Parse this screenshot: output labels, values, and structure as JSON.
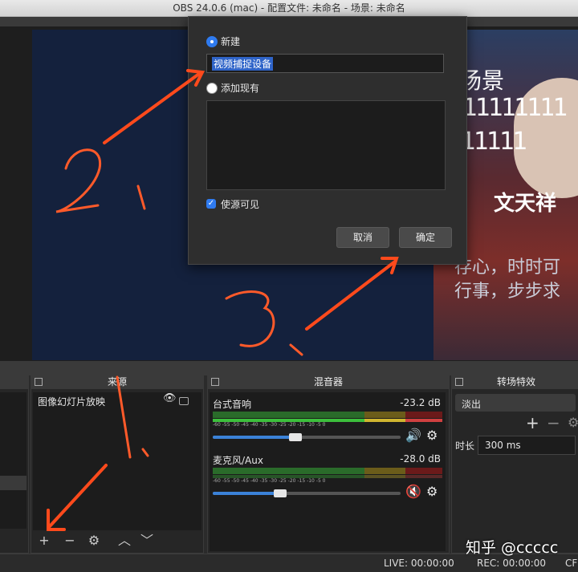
{
  "window": {
    "title": "OBS 24.0.6 (mac) - 配置文件: 未命名 - 场景: 未命名"
  },
  "preview": {
    "line1": "场景",
    "line2": "111111111",
    "line3": "11111",
    "name_text": "文天祥",
    "line4": "存心，时时可",
    "line5": "行事，步步求"
  },
  "dialog": {
    "new_label": "新建",
    "name_value": "视频捕捉设备",
    "add_existing_label": "添加现有",
    "visible_label": "使源可见",
    "cancel": "取消",
    "ok": "确定"
  },
  "sources": {
    "title": "来源",
    "items": [
      {
        "label": "图像幻灯片放映"
      }
    ]
  },
  "mixer": {
    "title": "混音器",
    "ticks": "-60  -55  -50  -45  -40  -35  -30  -25  -20  -15  -10   -5    0",
    "channels": [
      {
        "name": "台式音响",
        "db": "-23.2 dB",
        "volume": 0.44,
        "muted": false
      },
      {
        "name": "麦克风/Aux",
        "db": "-28.0 dB",
        "volume": 0.36,
        "muted": true
      }
    ]
  },
  "transitions": {
    "title": "转场特效",
    "selected": "淡出",
    "duration_label": "时长",
    "duration_value": "300 ms"
  },
  "status": {
    "live": "LIVE: 00:00:00",
    "rec": "REC: 00:00:00",
    "cpu": "CF"
  },
  "watermark": "知乎 @ccccc",
  "annotations": {
    "a1": "1.",
    "a2": "2.",
    "a3": "3."
  },
  "colors": {
    "accent": "#2f7bf0",
    "arrow": "#ff4a1c",
    "preview_bg": "#14213d"
  }
}
